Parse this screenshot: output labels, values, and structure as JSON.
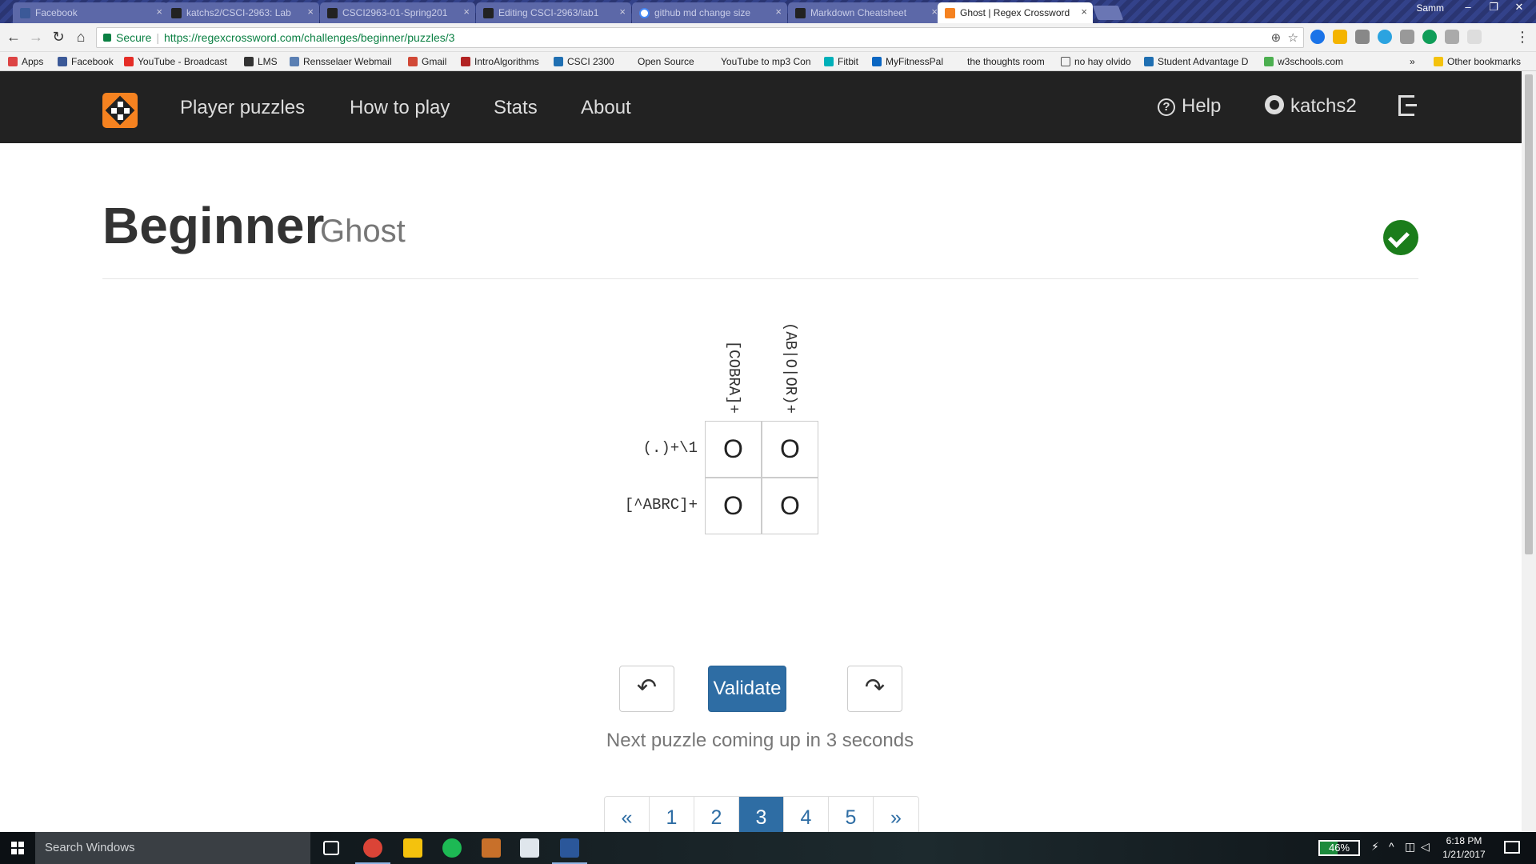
{
  "browser": {
    "tabs": [
      {
        "title": "Facebook",
        "icon": "facebook-icon",
        "color": "#3b5998"
      },
      {
        "title": "katchs2/CSCI-2963: Lab",
        "icon": "github-icon",
        "color": "#222222"
      },
      {
        "title": "CSCI2963-01-Spring201",
        "icon": "github-icon",
        "color": "#222222"
      },
      {
        "title": "Editing CSCI-2963/lab1",
        "icon": "github-icon",
        "color": "#222222"
      },
      {
        "title": "github md change size",
        "icon": "google-icon",
        "color": "#4285f4"
      },
      {
        "title": "Markdown Cheatsheet",
        "icon": "github-icon",
        "color": "#222222"
      },
      {
        "title": "Ghost | Regex Crossword",
        "icon": "regex-crossword-icon",
        "color": "#f58220"
      }
    ],
    "user": "Samm",
    "secure_label": "Secure",
    "url": "https://regexcrossword.com/challenges/beginner/puzzles/3",
    "bookmarks": [
      {
        "label": "Apps",
        "icon": "apps-grid-icon",
        "color": "#d44"
      },
      {
        "label": "Facebook",
        "icon": "facebook-icon",
        "color": "#3b5998"
      },
      {
        "label": "YouTube - Broadcast",
        "icon": "youtube-icon",
        "color": "#e52d27"
      },
      {
        "label": "LMS",
        "icon": "blackboard-icon",
        "color": "#333333"
      },
      {
        "label": "Rensselaer Webmail",
        "icon": "webmail-icon",
        "color": "#5a7fb3"
      },
      {
        "label": "Gmail",
        "icon": "gmail-icon",
        "color": "#d14836"
      },
      {
        "label": "IntroAlgorithms",
        "icon": "algorithms-icon",
        "color": "#b22222"
      },
      {
        "label": "CSCI 2300",
        "icon": "document-icon",
        "color": "#1f6fb2"
      },
      {
        "label": "Open Source",
        "icon": "folder-icon",
        "color": "#f2f2f2"
      },
      {
        "label": "YouTube to mp3 Con",
        "icon": "download-icon",
        "color": "#f2f2f2"
      },
      {
        "label": "Fitbit",
        "icon": "fitbit-icon",
        "color": "#00b0b9"
      },
      {
        "label": "MyFitnessPal",
        "icon": "myfitnesspal-icon",
        "color": "#0a66c2"
      },
      {
        "label": "the thoughts room",
        "icon": "lightbulb-icon",
        "color": "#f2f2f2"
      },
      {
        "label": "no hay olvido",
        "icon": "page-icon",
        "color": "#f2f2f2"
      },
      {
        "label": "Student Advantage D",
        "icon": "student-advantage-icon",
        "color": "#1f6fb2"
      },
      {
        "label": "w3schools.com",
        "icon": "w3schools-icon",
        "color": "#4caf50"
      }
    ],
    "other_bookmarks": "Other bookmarks",
    "overflow": "»"
  },
  "site": {
    "nav": [
      "Player puzzles",
      "How to play",
      "Stats",
      "About"
    ],
    "help": "Help",
    "username": "katchs2"
  },
  "puzzle": {
    "level": "Beginner",
    "name": "Ghost",
    "solved": true,
    "col_clues": [
      "[COBRA]+",
      "(AB|O|OR)+"
    ],
    "row_clues": [
      "(.)+\\1",
      "[^ABRC]+"
    ],
    "cells": [
      [
        "O",
        "O"
      ],
      [
        "O",
        "O"
      ]
    ],
    "validate_label": "Validate",
    "undo_icon": "undo-icon",
    "redo_icon": "redo-icon",
    "next_message": "Next puzzle coming up in 3 seconds"
  },
  "pagination": {
    "prev": "«",
    "pages": [
      "1",
      "2",
      "3",
      "4",
      "5"
    ],
    "current": "3",
    "next": "»"
  },
  "taskbar": {
    "search_placeholder": "Search Windows",
    "battery": "46%",
    "time": "6:18 PM",
    "date": "1/21/2017"
  },
  "colors": {
    "brand_orange": "#f58220",
    "nav_bg": "#222222",
    "primary_blue": "#2e6da4",
    "success_green": "#1b7d1b"
  }
}
